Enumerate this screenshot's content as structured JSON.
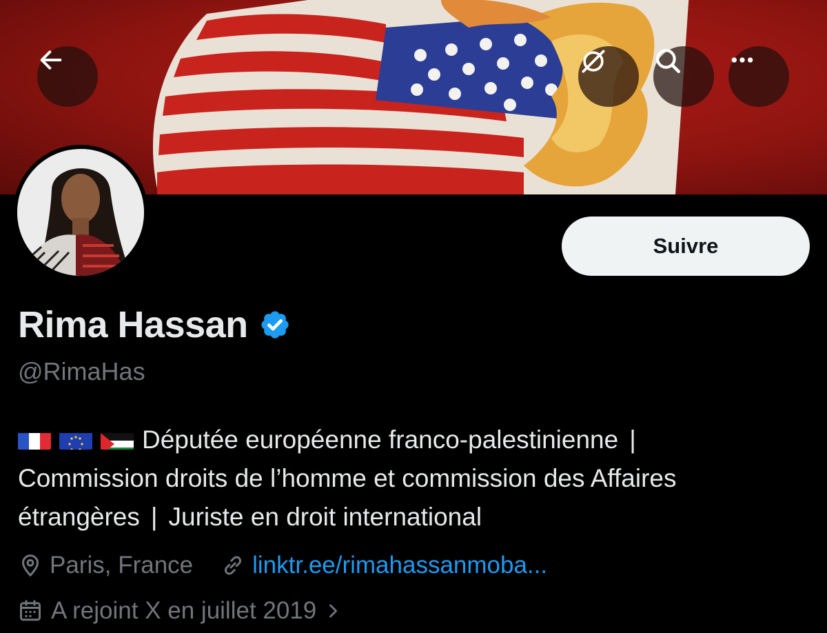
{
  "header": {
    "back_icon": "arrow-left-icon",
    "grok_icon": "grok-icon",
    "search_icon": "search-icon",
    "more_icon": "more-horizontal-icon"
  },
  "profile": {
    "display_name": "Rima Hassan",
    "verified": true,
    "verified_color": "#1d9bf0",
    "handle": "@RimaHas",
    "follow_label": "Suivre",
    "bio": {
      "flags": [
        "flag-france-icon",
        "flag-eu-icon",
        "flag-palestine-icon"
      ],
      "line1": "Députée européenne franco-palestinienne",
      "line2": "Commission droits de l’homme et commission des Affaires",
      "line3a": "étrangères",
      "line3b": "Juriste en droit international",
      "separator": "|"
    },
    "location": "Paris, France",
    "website": "linktr.ee/rimahassanmoba...",
    "joined": "A rejoint X en juillet 2019"
  },
  "colors": {
    "background": "#000000",
    "text_primary": "#e7e9ea",
    "text_secondary": "#71767b",
    "link": "#1d9bf0",
    "follow_bg": "#eff3f4"
  }
}
